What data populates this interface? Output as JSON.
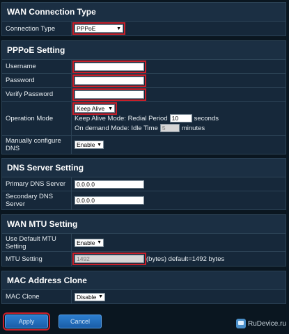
{
  "wan_connection_type": {
    "title": "WAN Connection Type",
    "connection_type_label": "Connection Type",
    "connection_type_value": "PPPoE"
  },
  "pppoe": {
    "title": "PPPoE Setting",
    "username_label": "Username",
    "username_value": "",
    "password_label": "Password",
    "password_value": "",
    "verify_password_label": "Verify Password",
    "verify_password_value": "",
    "operation_mode_label": "Operation Mode",
    "operation_mode_value": "Keep Alive",
    "keep_alive_text": "Keep Alive Mode: Redial Period",
    "redial_period_value": "10",
    "seconds_text": "seconds",
    "on_demand_text": "On demand Mode: Idle Time",
    "idle_time_value": "5",
    "minutes_text": "minutes",
    "manual_dns_label": "Manually configure DNS",
    "manual_dns_value": "Enable"
  },
  "dns": {
    "title": "DNS Server Setting",
    "primary_label": "Primary DNS Server",
    "primary_value": "0.0.0.0",
    "secondary_label": "Secondary DNS Server",
    "secondary_value": "0.0.0.0"
  },
  "mtu": {
    "title": "WAN MTU Setting",
    "use_default_label": "Use Default MTU Setting",
    "use_default_value": "Enable",
    "mtu_label": "MTU Setting",
    "mtu_value": "1492",
    "mtu_suffix": "(bytes) default=1492 bytes"
  },
  "mac": {
    "title": "MAC Address Clone",
    "mac_clone_label": "MAC Clone",
    "mac_clone_value": "Disable"
  },
  "buttons": {
    "apply": "Apply",
    "cancel": "Cancel"
  },
  "watermark": {
    "text": "RuDevice.ru"
  },
  "colors": {
    "background": "#0a1620",
    "panel": "#16283a",
    "highlight": "#c8202a",
    "button": "#1a5ea8"
  }
}
